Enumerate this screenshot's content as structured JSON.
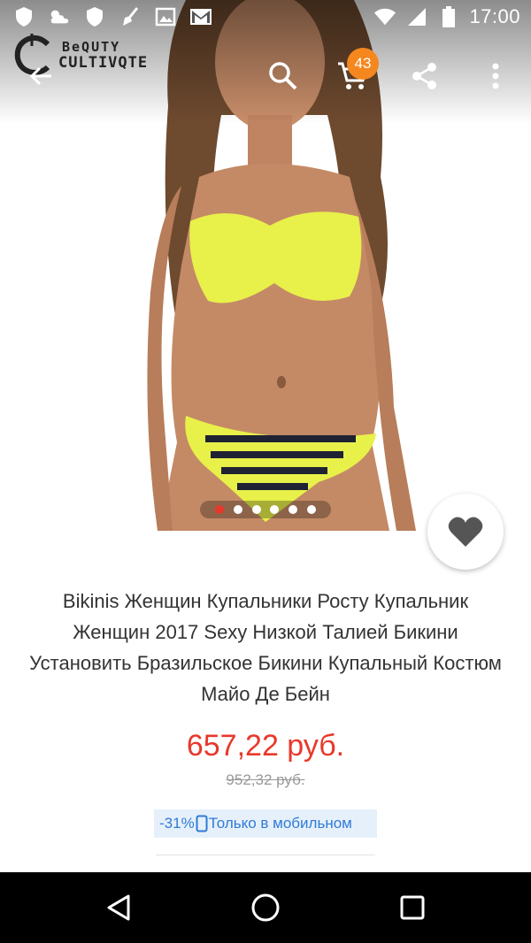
{
  "status_bar": {
    "time": "17:00",
    "icons": [
      "shield-icon",
      "weather-icon",
      "shield-icon",
      "broom-icon",
      "image-icon",
      "gmail-icon",
      "wifi-icon",
      "signal-icon",
      "battery-icon"
    ]
  },
  "toolbar": {
    "brand_line1": "BeQUTY",
    "brand_line2": "CULTIVQTE",
    "cart_count": "43",
    "icons": [
      "back-arrow-icon",
      "search-icon",
      "cart-icon",
      "share-icon",
      "more-vert-icon"
    ]
  },
  "gallery": {
    "image": "product-photo",
    "total_pages": 6,
    "current_page": 1,
    "accent_color": "#e8382b"
  },
  "product": {
    "title": "Bikinis Женщин Купальники Росту Купальник Женщин 2017 Sexy Низкой Талией Бикини Установить Бразильское Бикини Купальный Костюм Майо Де Бейн",
    "price": "657,22 руб.",
    "old_price": "952,32 руб.",
    "discount": "-31%",
    "mobile_only": "Только в мобильном",
    "price_color": "#e8382b",
    "promo_color": "#2f7bd6"
  },
  "nav_bar": {
    "icons": [
      "nav-back-icon",
      "nav-home-icon",
      "nav-recent-icon"
    ]
  }
}
